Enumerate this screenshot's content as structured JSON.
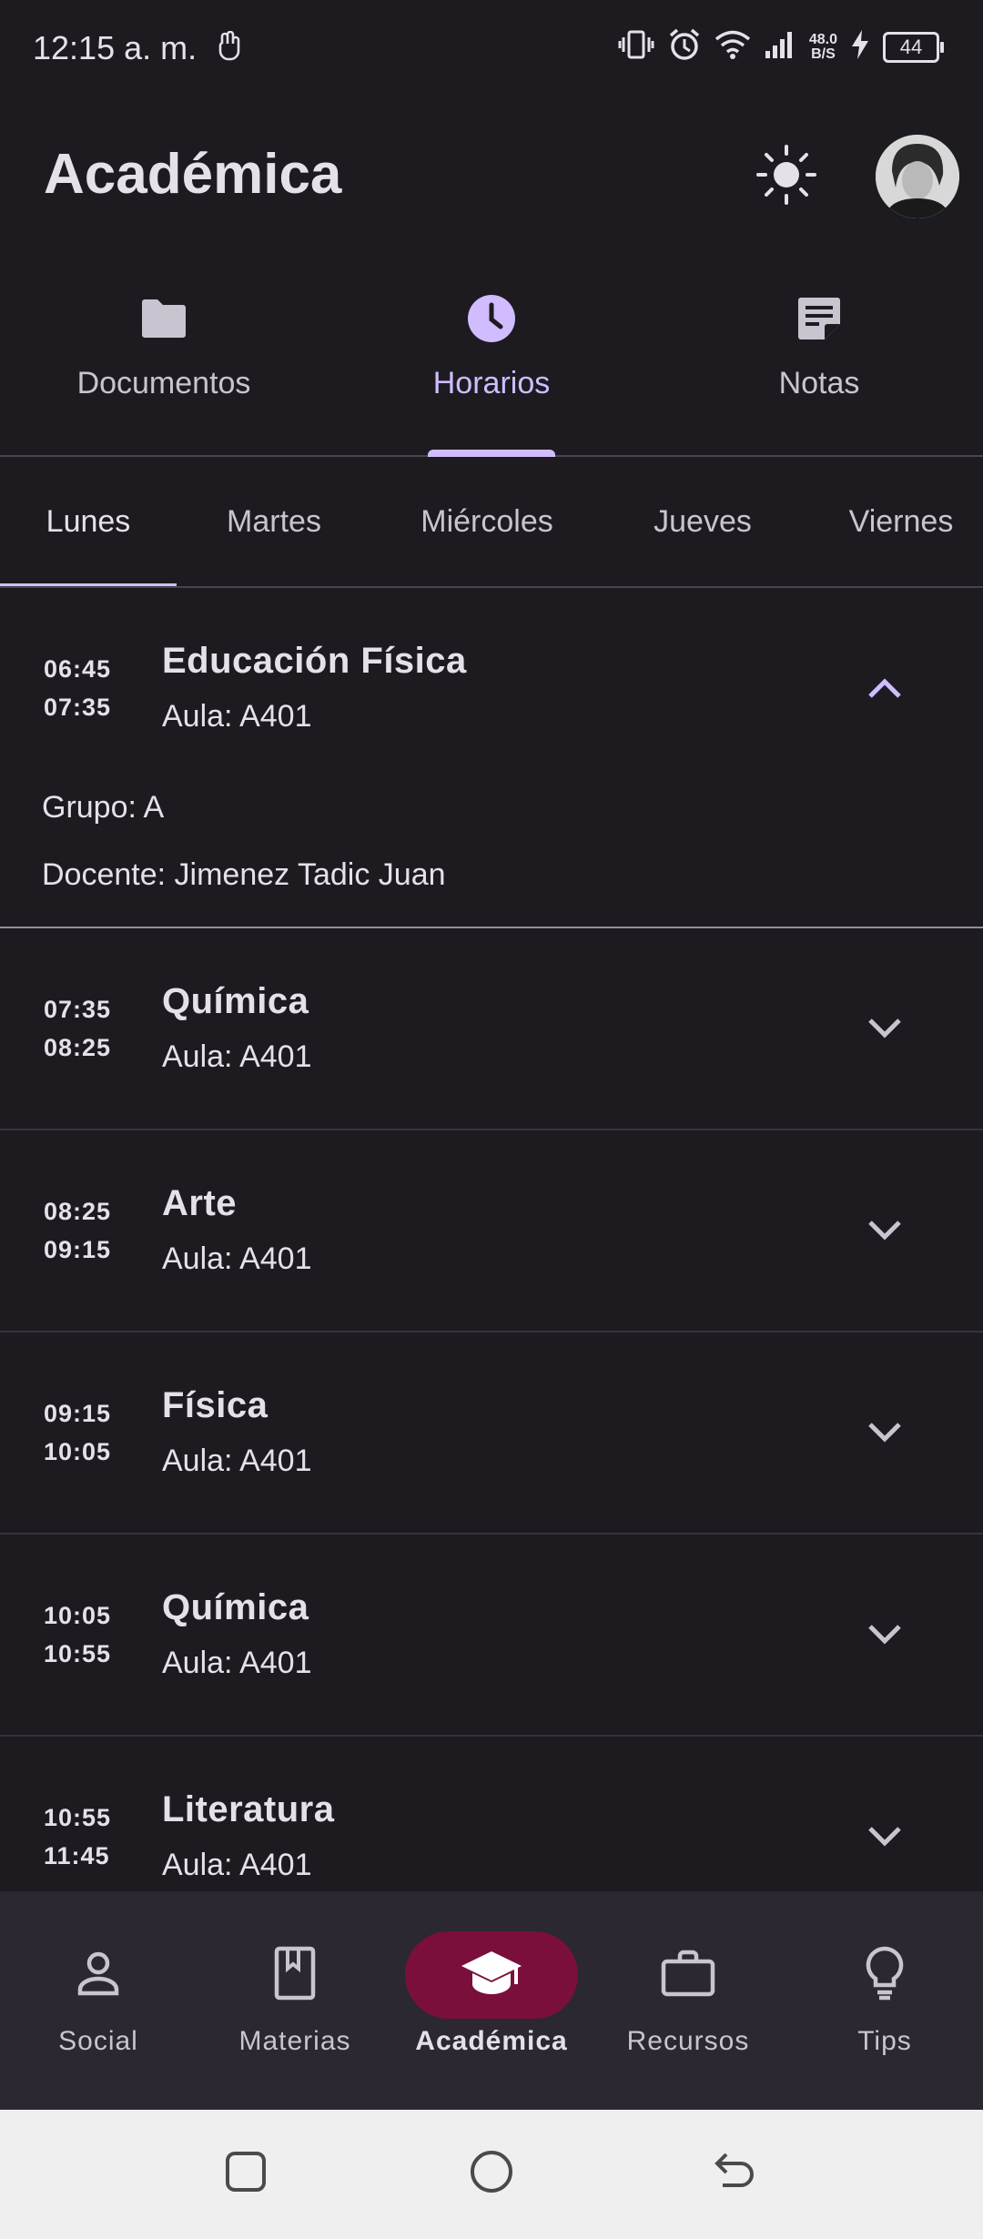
{
  "status_bar": {
    "time": "12:15 a. m.",
    "net_speed_value": "48.0",
    "net_speed_unit": "B/S",
    "battery": "44"
  },
  "app_bar": {
    "title": "Académica"
  },
  "primary_tabs": [
    {
      "label": "Documentos",
      "icon": "folder-icon",
      "active": false
    },
    {
      "label": "Horarios",
      "icon": "clock-icon",
      "active": true
    },
    {
      "label": "Notas",
      "icon": "note-icon",
      "active": false
    }
  ],
  "day_tabs": [
    {
      "label": "Lunes",
      "active": true
    },
    {
      "label": "Martes",
      "active": false
    },
    {
      "label": "Miércoles",
      "active": false
    },
    {
      "label": "Jueves",
      "active": false
    },
    {
      "label": "Viernes",
      "active": false
    }
  ],
  "schedule": [
    {
      "start": "06:45",
      "end": "07:35",
      "subject": "Educación Física",
      "room": "Aula: A401",
      "expanded": true,
      "group": "Grupo: A",
      "teacher": "Docente: Jimenez Tadic Juan"
    },
    {
      "start": "07:35",
      "end": "08:25",
      "subject": "Química",
      "room": "Aula: A401",
      "expanded": false
    },
    {
      "start": "08:25",
      "end": "09:15",
      "subject": "Arte",
      "room": "Aula: A401",
      "expanded": false
    },
    {
      "start": "09:15",
      "end": "10:05",
      "subject": "Física",
      "room": "Aula: A401",
      "expanded": false
    },
    {
      "start": "10:05",
      "end": "10:55",
      "subject": "Química",
      "room": "Aula: A401",
      "expanded": false
    },
    {
      "start": "10:55",
      "end": "11:45",
      "subject": "Literatura",
      "room": "Aula: A401",
      "expanded": false
    }
  ],
  "bottom_nav": [
    {
      "label": "Social",
      "icon": "person-icon",
      "active": false
    },
    {
      "label": "Materias",
      "icon": "book-icon",
      "active": false
    },
    {
      "label": "Académica",
      "icon": "graduation-cap-icon",
      "active": true
    },
    {
      "label": "Recursos",
      "icon": "briefcase-icon",
      "active": false
    },
    {
      "label": "Tips",
      "icon": "lightbulb-icon",
      "active": false
    }
  ],
  "colors": {
    "background": "#1d1b20",
    "accent": "#d0bcff",
    "nav_active_pill": "#7b0f3c",
    "nav_background": "#2b2831",
    "divider": "#49454f"
  }
}
